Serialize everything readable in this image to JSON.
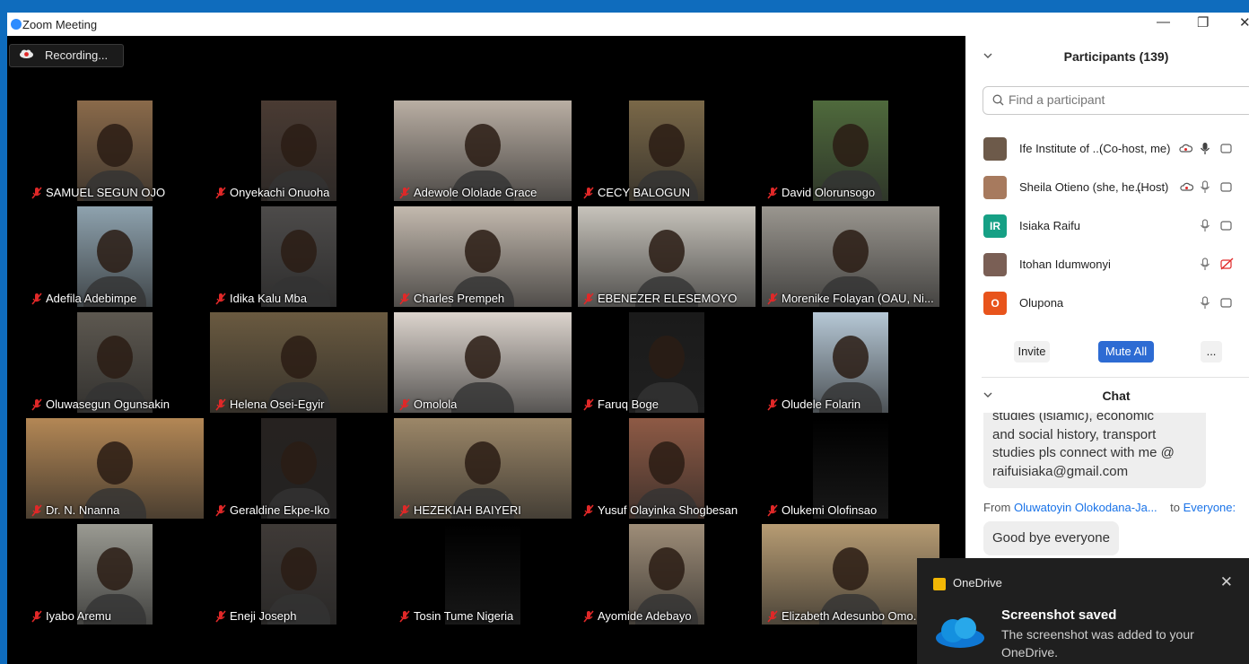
{
  "window": {
    "title": "Zoom Meeting",
    "minimize": "—",
    "restore": "❐",
    "close": "✕"
  },
  "recording": {
    "label": "Recording..."
  },
  "participants_grid": [
    {
      "name": "SAMUEL SEGUN OJO",
      "tone": "#8a6a4a"
    },
    {
      "name": "Onyekachi Onuoha",
      "tone": "#4a3b33"
    },
    {
      "name": "Adewole Ololade Grace",
      "tone": "#b9aea3"
    },
    {
      "name": "CECY BALOGUN",
      "tone": "#7a6848"
    },
    {
      "name": "David Olorunsogo",
      "tone": "#4f6a3c"
    },
    {
      "name": "Adefila Adebimpe",
      "tone": "#8ea2ae"
    },
    {
      "name": "Idika Kalu Mba",
      "tone": "#4d4b4a"
    },
    {
      "name": "Charles Prempeh",
      "tone": "#c3b9ae"
    },
    {
      "name": "EBENEZER ELESEMOYO",
      "tone": "#c7c3bb"
    },
    {
      "name": "Morenike Folayan (OAU, Ni...",
      "tone": "#9a968f"
    },
    {
      "name": "Oluwasegun Ogunsakin",
      "tone": "#5d5850"
    },
    {
      "name": "Helena Osei-Egyir",
      "tone": "#6a5a40"
    },
    {
      "name": "Omolola",
      "tone": "#dcd4cd"
    },
    {
      "name": "Faruq Boge",
      "tone": "#1a1a1a"
    },
    {
      "name": "Oludele Folarin",
      "tone": "#b6c8d6"
    },
    {
      "name": "Dr. N. Nnanna",
      "tone": "#b38755"
    },
    {
      "name": "Geraldine Ekpe-Iko",
      "tone": "#262220"
    },
    {
      "name": "HEZEKIAH BAIYERI",
      "tone": "#9c8768"
    },
    {
      "name": "Yusuf Olayinka Shogbesan",
      "tone": "#8e5a45"
    },
    {
      "name": "Olukemi Olofinsao",
      "tone": "#000000"
    },
    {
      "name": "Iyabo Aremu",
      "tone": "#9a9a92"
    },
    {
      "name": "Eneji Joseph",
      "tone": "#3f3a37"
    },
    {
      "name": "Tosin Tume Nigeria",
      "tone": "#000000"
    },
    {
      "name": "Ayomide Adebayo",
      "tone": "#9e8d78"
    },
    {
      "name": "Elizabeth Adesunbo Omo...",
      "tone": "#b79c73"
    }
  ],
  "panel": {
    "participants_title": "Participants (139)",
    "search_placeholder": "Find a participant",
    "list": [
      {
        "name": "Ife Institute of ...",
        "role": "(Co-host, me)",
        "avatar": "",
        "avatar_color": "#6d5a4a",
        "video_off": false
      },
      {
        "name": "Sheila Otieno (she, he...",
        "role": "(Host)",
        "avatar": "",
        "avatar_color": "#a77a5e",
        "video_off": false
      },
      {
        "name": "Isiaka Raifu",
        "role": "",
        "avatar": "IR",
        "avatar_color": "#16a085",
        "video_off": false
      },
      {
        "name": "Itohan Idumwonyi",
        "role": "",
        "avatar": "",
        "avatar_color": "#7a5f55",
        "video_off": true
      },
      {
        "name": "Olupona",
        "role": "",
        "avatar": "O",
        "avatar_color": "#e8541c",
        "video_off": false
      }
    ],
    "invite": "Invite",
    "mute_all": "Mute All",
    "more": "...",
    "chat_title": "Chat",
    "chat_message_1": [
      "studies (islamic), economic",
      "and social history, transport",
      "studies pls connect with me @",
      "raifuisiaka@gmail.com"
    ],
    "from_label": "From",
    "from_name": "Oluwatoyin Olokodana-Ja...",
    "to_label": "to",
    "to_name": "Everyone:",
    "chat_message_2": "Good bye everyone"
  },
  "toast": {
    "app": "OneDrive",
    "close": "✕",
    "title": "Screenshot saved",
    "body": "The screenshot was added to your OneDrive."
  }
}
